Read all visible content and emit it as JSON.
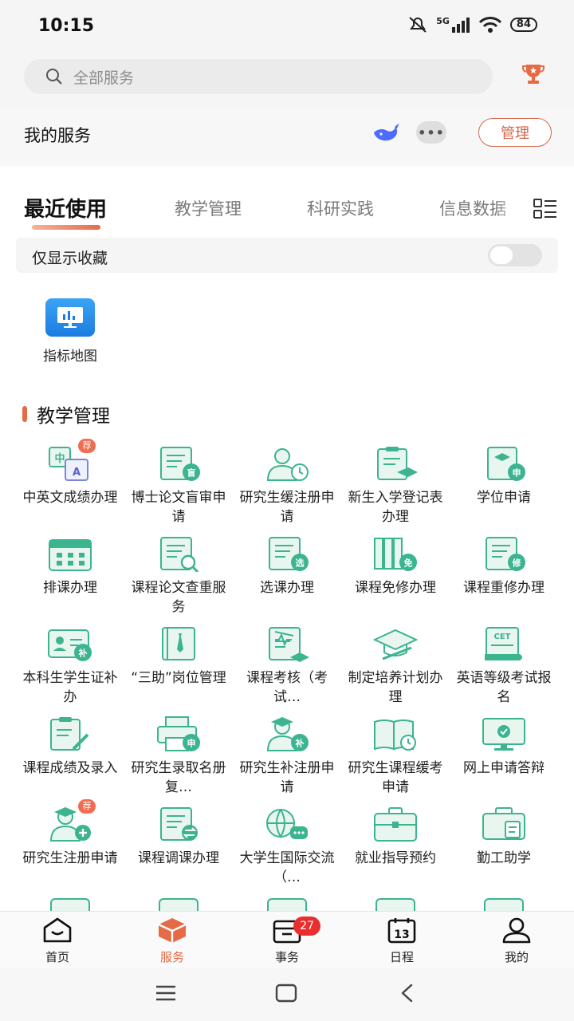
{
  "status": {
    "time": "10:15",
    "network": "5G",
    "battery": "84"
  },
  "search": {
    "placeholder": "全部服务"
  },
  "my_services": {
    "title": "我的服务",
    "more": "•••",
    "manage_label": "管理"
  },
  "tabs": [
    {
      "label": "最近使用",
      "active": true
    },
    {
      "label": "教学管理"
    },
    {
      "label": "科研实践"
    },
    {
      "label": "信息数据"
    }
  ],
  "favorites_toggle": {
    "label": "仅显示收藏",
    "on": false
  },
  "recent_apps": [
    {
      "label": "指标地图",
      "icon": "monitor-chart-icon"
    }
  ],
  "section": {
    "title": "教学管理"
  },
  "apps": [
    {
      "label": "中英文成绩办理",
      "icon": "chinese-english-icon",
      "badge": "荐"
    },
    {
      "label": "博士论文盲审申请",
      "icon": "document-blind-review-icon",
      "glyph": "盲"
    },
    {
      "label": "研究生缓注册申请",
      "icon": "user-clock-icon"
    },
    {
      "label": "新生入学登记表办理",
      "icon": "clipboard-graduation-icon"
    },
    {
      "label": "学位申请",
      "icon": "degree-apply-icon",
      "glyph": "申"
    },
    {
      "label": "排课办理",
      "icon": "calendar-icon"
    },
    {
      "label": "课程论文查重服务",
      "icon": "document-search-icon"
    },
    {
      "label": "选课办理",
      "icon": "course-select-icon",
      "glyph": "选"
    },
    {
      "label": "课程免修办理",
      "icon": "books-exempt-icon",
      "glyph": "免"
    },
    {
      "label": "课程重修办理",
      "icon": "course-retake-icon",
      "glyph": "修"
    },
    {
      "label": "本科生学生证补办",
      "icon": "id-card-icon",
      "glyph": "补"
    },
    {
      "label": "“三助”岗位管理",
      "icon": "notebook-tie-icon"
    },
    {
      "label": "课程考核（考试…",
      "icon": "exam-assessment-icon"
    },
    {
      "label": "制定培养计划办理",
      "icon": "graduation-cap-pen-icon"
    },
    {
      "label": "英语等级考试报名",
      "icon": "cet-scroll-icon",
      "glyph": "CET"
    },
    {
      "label": "课程成绩及录入",
      "icon": "clipboard-pencil-icon"
    },
    {
      "label": "研究生录取名册复…",
      "icon": "printer-apply-icon",
      "glyph": "申"
    },
    {
      "label": "研究生补注册申请",
      "icon": "graduate-supplement-icon",
      "glyph": "补"
    },
    {
      "label": "研究生课程缓考申请",
      "icon": "book-clock-icon"
    },
    {
      "label": "网上申请答辩",
      "icon": "monitor-check-icon"
    },
    {
      "label": "研究生注册申请",
      "icon": "graduate-register-icon",
      "badge": "荐"
    },
    {
      "label": "课程调课办理",
      "icon": "document-swap-icon"
    },
    {
      "label": "大学生国际交流（…",
      "icon": "globe-chat-icon"
    },
    {
      "label": "就业指导预约",
      "icon": "briefcase-icon"
    },
    {
      "label": "勤工助学",
      "icon": "toolbox-icon"
    }
  ],
  "bottom_nav": [
    {
      "label": "首页",
      "icon": "home-icon"
    },
    {
      "label": "服务",
      "icon": "service-box-icon",
      "active": true
    },
    {
      "label": "事务",
      "icon": "inbox-icon",
      "badge": "27"
    },
    {
      "label": "日程",
      "icon": "calendar-13-icon",
      "glyph": "13"
    },
    {
      "label": "我的",
      "icon": "profile-icon"
    }
  ],
  "colors": {
    "accent": "#e56a46",
    "icon_green": "#3bb48f",
    "icon_fill": "#e9f6f0",
    "badge_red": "#e82e2e"
  }
}
